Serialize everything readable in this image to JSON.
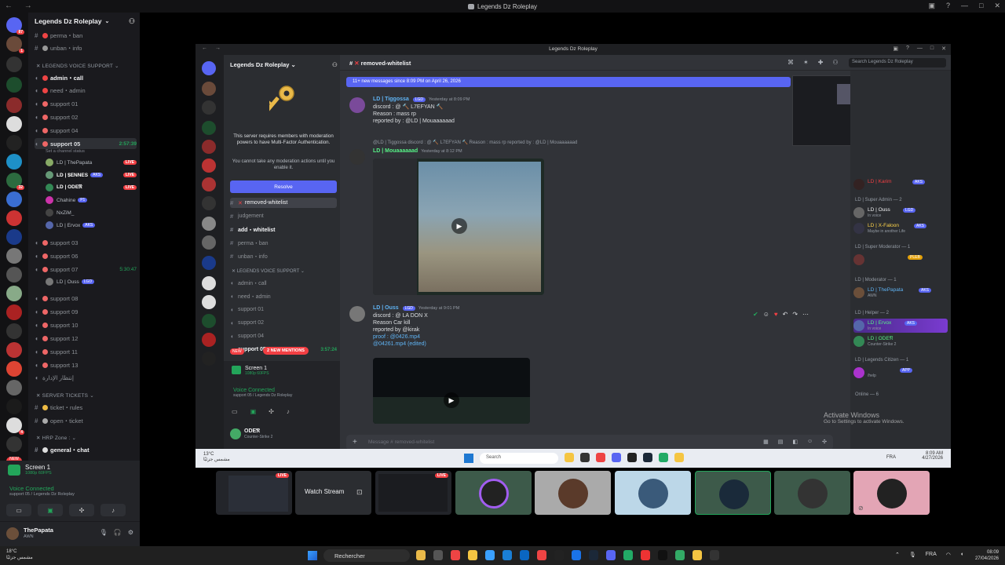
{
  "window": {
    "title": "Legends Dz Roleplay"
  },
  "sidebar": {
    "server_name": "Legends Dz Roleplay",
    "server_badges": [
      "87",
      "1",
      "32",
      "4"
    ],
    "channels_top": [
      {
        "label": "perma・ban"
      },
      {
        "label": "unban・info"
      }
    ],
    "voice_category": "LEGENDS VOICE SUPPORT",
    "voice_channels": [
      {
        "label": "admin・call"
      },
      {
        "label": "need・admin"
      },
      {
        "label": "support 01"
      },
      {
        "label": "support 02"
      },
      {
        "label": "support 04"
      },
      {
        "label": "support 05",
        "timer": "2:57:39",
        "status": "Set a channel status"
      },
      {
        "label": "support 03"
      },
      {
        "label": "support 06"
      },
      {
        "label": "support 07",
        "timer": "5:30:47"
      },
      {
        "label": "support 08"
      },
      {
        "label": "support 09"
      },
      {
        "label": "support 10"
      },
      {
        "label": "support 12"
      },
      {
        "label": "support 11"
      },
      {
        "label": "support 13"
      },
      {
        "label": "إنتظار الإدارة"
      }
    ],
    "voice_users_05": [
      {
        "name": "LD | ThePapata",
        "live": "LIVE"
      },
      {
        "name": "LD | $ENNES",
        "tag": "AKS",
        "live": "LIVE"
      },
      {
        "name": "LD | ODE𝔑",
        "live": "LIVE"
      },
      {
        "name": "Chahine",
        "tag": "P1"
      },
      {
        "name": "NxZiM_"
      },
      {
        "name": "LD | Ervox",
        "tag": "AKS"
      }
    ],
    "voice_users_07": [
      {
        "name": "LD | Ouss",
        "tag": "LGD"
      }
    ],
    "server_tickets_category": "SERVER TICKETS",
    "ticket_channels": [
      {
        "label": "ticket・rules"
      },
      {
        "label": "open・ticket"
      }
    ],
    "hrp_category": "HRP Zone :",
    "hrp_channels": [
      {
        "label": "general・chat"
      }
    ],
    "new_pill": "NEW"
  },
  "screen_panel": {
    "title": "Screen 1",
    "sub": "1080p 60FPS",
    "voice_status": "Voice Connected",
    "voice_sub": "support 05 / Legends Dz Roleplay"
  },
  "user": {
    "name": "ThePapata",
    "status": "AWN"
  },
  "inner": {
    "window_title": "Legends Dz Roleplay",
    "server_name": "Legends Dz Roleplay",
    "mfa_text": "This server requires members with moderation powers to have Multi-Factor Authentication.",
    "mfa_sub": "You cannot take any moderation actions until you enable it.",
    "resolve_label": "Resolve",
    "channels": [
      {
        "label": "removed-whitelist",
        "active": true
      },
      {
        "label": "judgement"
      },
      {
        "label": "add・whitelist",
        "bright": true
      },
      {
        "label": "perma・ban"
      },
      {
        "label": "unban・info"
      }
    ],
    "voice_category": "LEGENDS VOICE SUPPORT",
    "voice_channels": [
      {
        "label": "admin・call"
      },
      {
        "label": "need・admin"
      },
      {
        "label": "support 01"
      },
      {
        "label": "support 02"
      },
      {
        "label": "support 04"
      },
      {
        "label": "support 05",
        "timer": "3:57:24"
      }
    ],
    "new_mentions": "2 NEW MENTIONS",
    "new_pill": "NEW",
    "screen_title": "Screen 1",
    "screen_sub": "1080p 60FPS",
    "voice_status": "Voice Connected",
    "voice_sub": "support 05 / Legends Dz Roleplay",
    "user_name": "ODE𝔑",
    "user_status": "Counter-Strike 2"
  },
  "chat": {
    "channel": "removed-whitelist",
    "search_placeholder": "Search Legends Dz Roleplay",
    "new_messages_bar": "11+ new messages since 8:09 PM on April 26, 2026",
    "messages": [
      {
        "author": "LD | Tiggossa",
        "badge": "LGD",
        "time": "Yesterday at 8:09 PM",
        "lines": [
          "discord : @ 🔨 L7EFYAN 🔨",
          "Reason : mass rp",
          "reported by : @LD | Mouaaaaaad"
        ]
      },
      {
        "reply": "@LD | Tiggossa  discord : @ 🔨 L7EFYAN 🔨  Reason : mass rp reported by : @LD | Mouaaaaaad",
        "author": "LD | Mouaaaaaad",
        "time": "Yesterday at 8:12 PM"
      },
      {
        "author": "LD | Ouss",
        "badge": "LGD",
        "time": "Yesterday at 9:01 PM",
        "lines": [
          "discord : @ LA DON X",
          "Reason Car kill",
          "reported by @kirak",
          "proof : @0426.mp4",
          "@04261.mp4 (edited)"
        ]
      }
    ],
    "composer_placeholder": "Message #  removed-whitelist"
  },
  "members": {
    "groups": [
      {
        "label": "LD | Super Admin — 2",
        "members": [
          {
            "name": "LD | Ouss",
            "tag": "LGD",
            "status": "In voice"
          },
          {
            "name": "LD | X-Faloon",
            "tag": "AKS",
            "status": "Maybe in another Life"
          }
        ]
      },
      {
        "label": "LD | Super Moderator — 1",
        "members": [
          {
            "name": "",
            "tag": "PLEB"
          }
        ]
      },
      {
        "label": "LD | Moderator — 1",
        "members": [
          {
            "name": "LD | ThePapata",
            "tag": "AKS",
            "status": "AWN"
          }
        ]
      },
      {
        "label": "LD | Helper — 2",
        "members": [
          {
            "name": "LD | Ervox",
            "tag": "AKS",
            "status": "In voice"
          },
          {
            "name": "LD | ODE𝔑",
            "status": "Counter-Strike 2"
          }
        ]
      },
      {
        "label": "LD | Legends Citizen — 1",
        "members": [
          {
            "name": "",
            "tag": "APP",
            "status": "/help"
          }
        ]
      },
      {
        "label": "Online — 6",
        "members": []
      }
    ],
    "top_members": [
      {
        "name": "LD | Karim",
        "tag": "AKS"
      }
    ]
  },
  "activate_windows": {
    "title": "Activate Windows",
    "sub": "Go to Settings to activate Windows."
  },
  "inner_taskbar": {
    "weather_temp": "13°C",
    "weather_sub": "مشمس جزئيًا",
    "search": "Search",
    "lang": "FRA",
    "time": "8:09 AM",
    "date": "4/27/2026"
  },
  "tiles": {
    "live": "LIVE",
    "watch_stream": "Watch Stream"
  },
  "taskbar": {
    "weather_temp": "18°C",
    "weather_sub": "مشمس جزئيًا",
    "search": "Rechercher",
    "lang": "FRA",
    "time": "08:09",
    "date": "27/04/2026"
  },
  "colors": {
    "accent": "#5865f2",
    "live": "#f23f43",
    "online": "#23a55a"
  }
}
